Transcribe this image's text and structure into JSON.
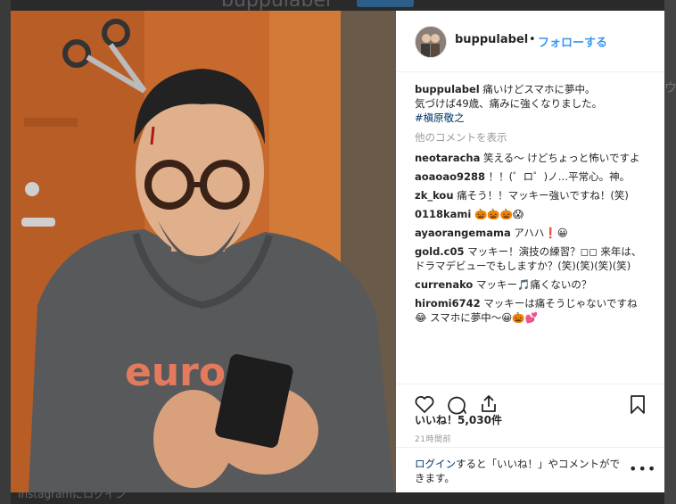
{
  "backdrop": {
    "profile_name": "buppulabel",
    "footer": "Instagramにログイン",
    "right_edge_text": "ウ"
  },
  "post": {
    "username": "buppulabel",
    "follow_label": "フォローする",
    "caption": {
      "line1": "痛いけどスマホに夢中。",
      "line2": "気づけば49歳、痛みに強くなりました。",
      "hashtag": "#槇原敬之"
    },
    "more_comments": "他のコメントを表示",
    "comments": [
      {
        "user": "neotaracha",
        "text": "笑える〜 けどちょっと怖いですよ"
      },
      {
        "user": "aoaoao9288",
        "text": "！！(゜ロ゜)ノ…平常心。神。"
      },
      {
        "user": "zk_kou",
        "text": "痛そう！！マッキー強いですね！(笑)"
      },
      {
        "user": "0118kami",
        "text": "🎃🎃🎃😱"
      },
      {
        "user": "ayaorangemama",
        "text": "アハハ❗😀"
      },
      {
        "user": "gold.c05",
        "text": "マッキー！演技の練習？◻︎◻︎ 来年は、ドラマデビューでもしますか？(笑)(笑)(笑)(笑)"
      },
      {
        "user": "currenako",
        "text": "マッキー🎵痛くないの？"
      },
      {
        "user": "hiromi6742",
        "text": "マッキーは痛そうじゃないですね😂 スマホに夢中〜😀🎃💕"
      }
    ],
    "likes": "いいね！5,030件",
    "time": "21時間前",
    "login_link": "ログイン",
    "login_rest": "すると「いいね！」やコメントができます。",
    "more_options": "•••"
  },
  "photo": {
    "sweatshirt_text": "europa"
  },
  "icons": {
    "like": "heart-icon",
    "comment": "comment-icon",
    "share": "share-icon",
    "save": "bookmark-icon"
  },
  "colors": {
    "link_blue": "#3897f0",
    "hashtag": "#003569",
    "secondary": "#999999"
  }
}
